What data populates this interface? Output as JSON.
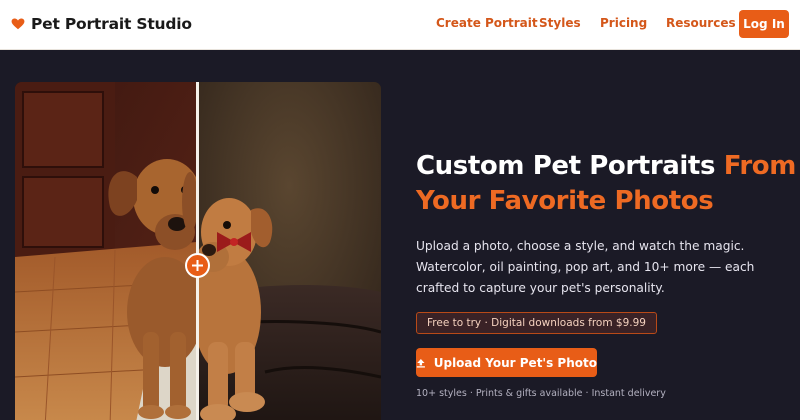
{
  "brand": {
    "name": "Pet Portrait Studio",
    "icon": "heart-icon",
    "color": "#e85d17"
  },
  "nav": {
    "links": [
      "Create Portrait",
      "Styles",
      "Pricing",
      "Resources"
    ],
    "login_label": "Log In"
  },
  "compare": {
    "before_icon": "original-photo",
    "after_icon": "portrait-render",
    "handle_icon": "plus-icon"
  },
  "hero": {
    "title_plain": "Custom Pet Portraits",
    "title_accent": "From Your Favorite Photos",
    "subtitle": "Upload a photo, choose a style, and watch the magic. Watercolor, oil painting, pop art, and 10+ more — each crafted to capture your pet's personality.",
    "promo": "Free to try · Digital downloads from $9.99",
    "upload_label": "Upload Your Pet's Photo",
    "upload_icon": "upload-icon",
    "features": "10+ styles · Prints & gifts available · Instant delivery"
  },
  "colors": {
    "accent": "#e85d17",
    "background": "#1b1a26",
    "nav_bg": "#ffffff"
  }
}
